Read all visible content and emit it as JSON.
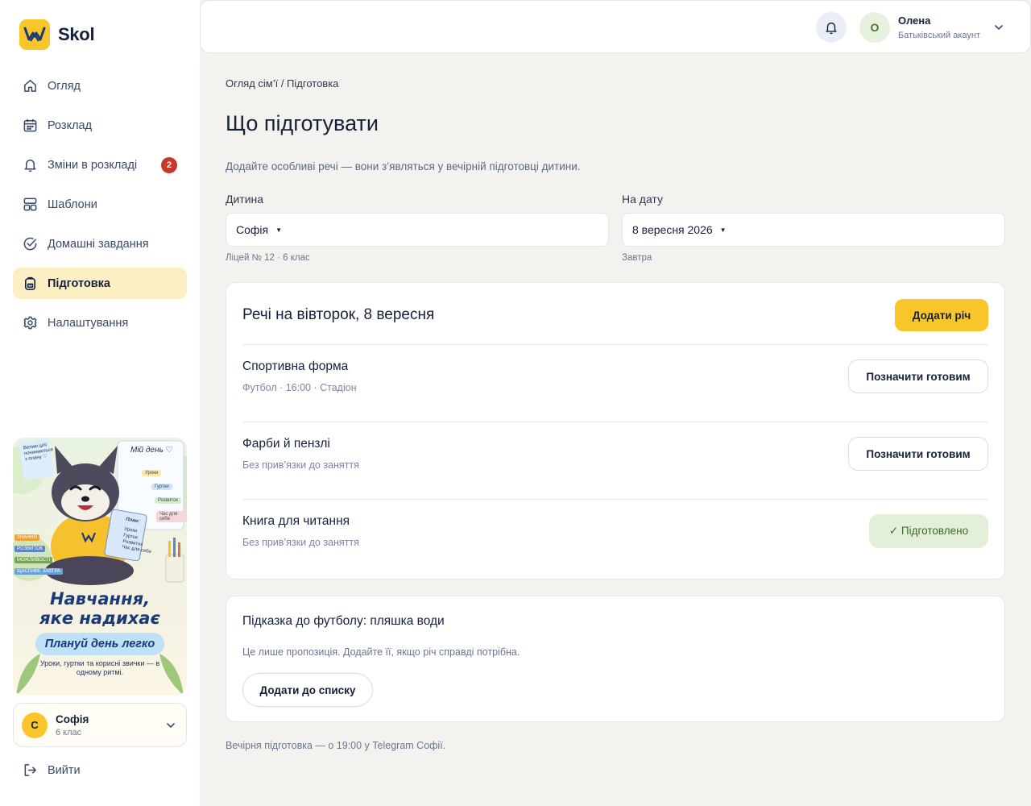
{
  "brand": {
    "name": "Skol",
    "accent": "#f8c62a"
  },
  "sidebar": {
    "items": [
      {
        "label": "Огляд",
        "icon": "home-icon",
        "active": false
      },
      {
        "label": "Розклад",
        "icon": "calendar-icon",
        "active": false
      },
      {
        "label": "Зміни в розкладі",
        "icon": "bell-icon",
        "active": false,
        "badge": "2"
      },
      {
        "label": "Шаблони",
        "icon": "template-icon",
        "active": false
      },
      {
        "label": "Домашні завдання",
        "icon": "check-circle-icon",
        "active": false
      },
      {
        "label": "Підготовка",
        "icon": "backpack-icon",
        "active": true
      },
      {
        "label": "Налаштування",
        "icon": "gear-icon",
        "active": false
      }
    ],
    "promo": {
      "title_line1": "Навчання,",
      "title_line2": "яке надихає",
      "pill": "Плануй день легко",
      "subtitle": "Уроки, гуртки та корисні звички — в одному ритмі.",
      "note": "Великі цілі починаються з плану ♡",
      "board_title": "Мій день ♡",
      "board_tags": [
        "Уроки",
        "Гуртки",
        "Розвиток",
        "Час для себе"
      ],
      "side_labels": [
        "ЗНАННЯ",
        "РОЗВИТОК",
        "МОЖЛИВОСТІ",
        "ЩАСЛИВЕ ЗАВТРА"
      ],
      "book_title": "План:",
      "book_items": [
        "Уроки",
        "Гуртки",
        "Розвиток",
        "Час для себе"
      ]
    },
    "child": {
      "initial": "С",
      "name": "Софія",
      "class": "6 клас"
    },
    "logout": "Вийти"
  },
  "header": {
    "user_initial": "О",
    "user_name": "Олена",
    "user_role": "Батьківський акаунт"
  },
  "main": {
    "breadcrumb": "Огляд сім’ї / Підготовка",
    "title": "Що підготувати",
    "description": "Додайте особливі речі — вони з’являться у вечірній підготовці дитини.",
    "child_field": {
      "label": "Дитина",
      "value": "Софія",
      "hint": "Ліцей № 12 · 6 клас"
    },
    "date_field": {
      "label": "На дату",
      "value": "8 вересня 2026",
      "hint": "Завтра"
    },
    "items_card": {
      "title": "Речі на вівторок, 8 вересня",
      "add_button": "Додати річ",
      "items": [
        {
          "name": "Спортивна форма",
          "meta": "Футбол · 16:00 · Стадіон",
          "action": "Позначити готовим",
          "done": false
        },
        {
          "name": "Фарби й пензлі",
          "meta": "Без прив’язки до заняття",
          "action": "Позначити готовим",
          "done": false
        },
        {
          "name": "Книга для читання",
          "meta": "Без прив’язки до заняття",
          "action": "✓ Підготовлено",
          "done": true
        }
      ]
    },
    "tip_card": {
      "title": "Підказка до футболу: пляшка води",
      "description": "Це лише пропозиція. Додайте її, якщо річ справді потрібна.",
      "button": "Додати до списку"
    },
    "footer_note": "Вечірня підготовка — о 19:00 у Telegram Софії."
  }
}
